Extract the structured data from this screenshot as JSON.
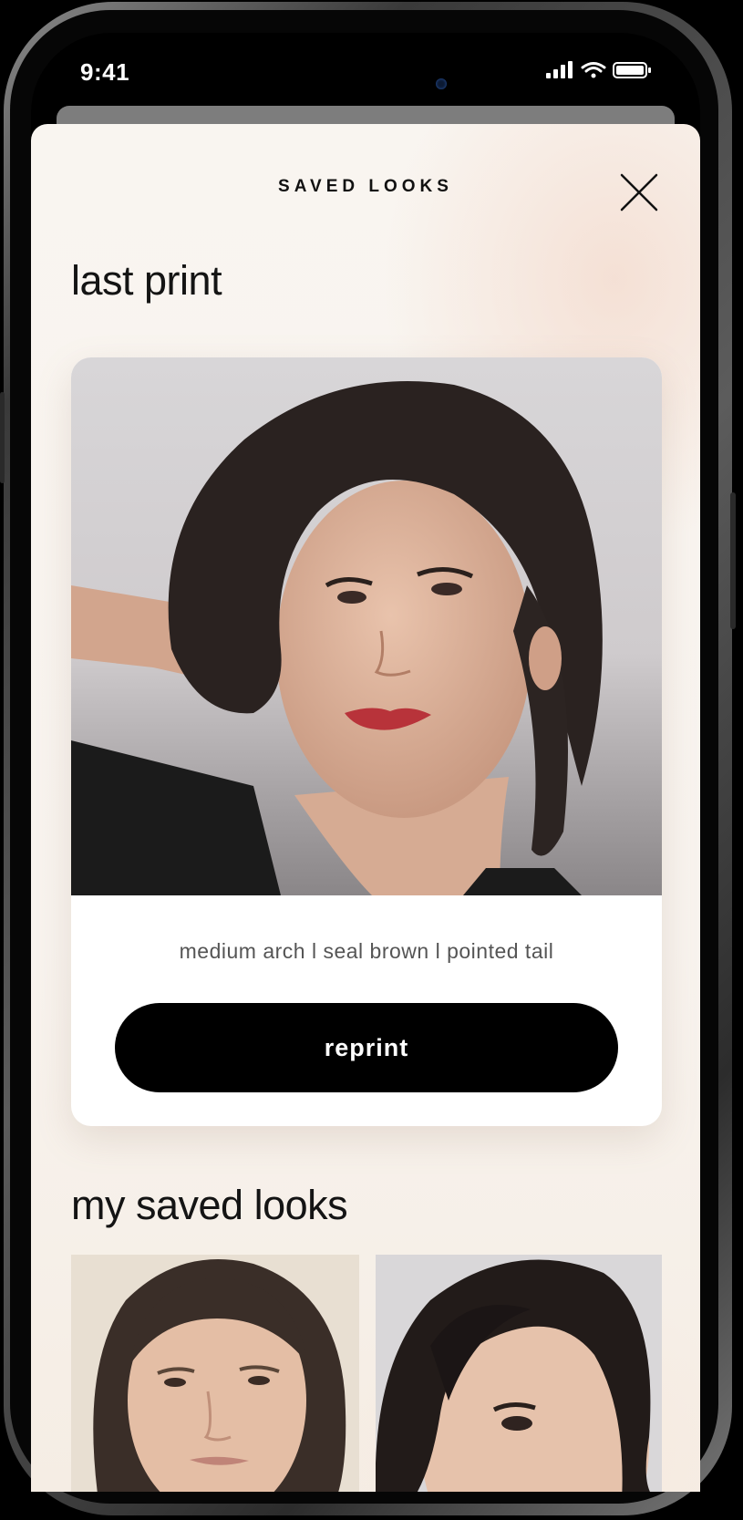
{
  "status_bar": {
    "time": "9:41",
    "icons": [
      "cellular-signal-icon",
      "wifi-icon",
      "battery-icon"
    ]
  },
  "sheet": {
    "title": "SAVED LOOKS",
    "close_icon": "close-icon"
  },
  "last_print": {
    "heading": "last print",
    "caption": "medium arch l seal brown l pointed tail",
    "reprint_label": "reprint"
  },
  "saved_looks": {
    "heading": "my saved looks",
    "items": [
      {
        "kind": "portrait-thumbnail"
      },
      {
        "kind": "portrait-thumbnail"
      }
    ]
  },
  "colors": {
    "sheet_bg": "#f8f3ee",
    "button_bg": "#000000",
    "button_text": "#ffffff",
    "text_primary": "#141414",
    "caption_text": "#555555"
  }
}
